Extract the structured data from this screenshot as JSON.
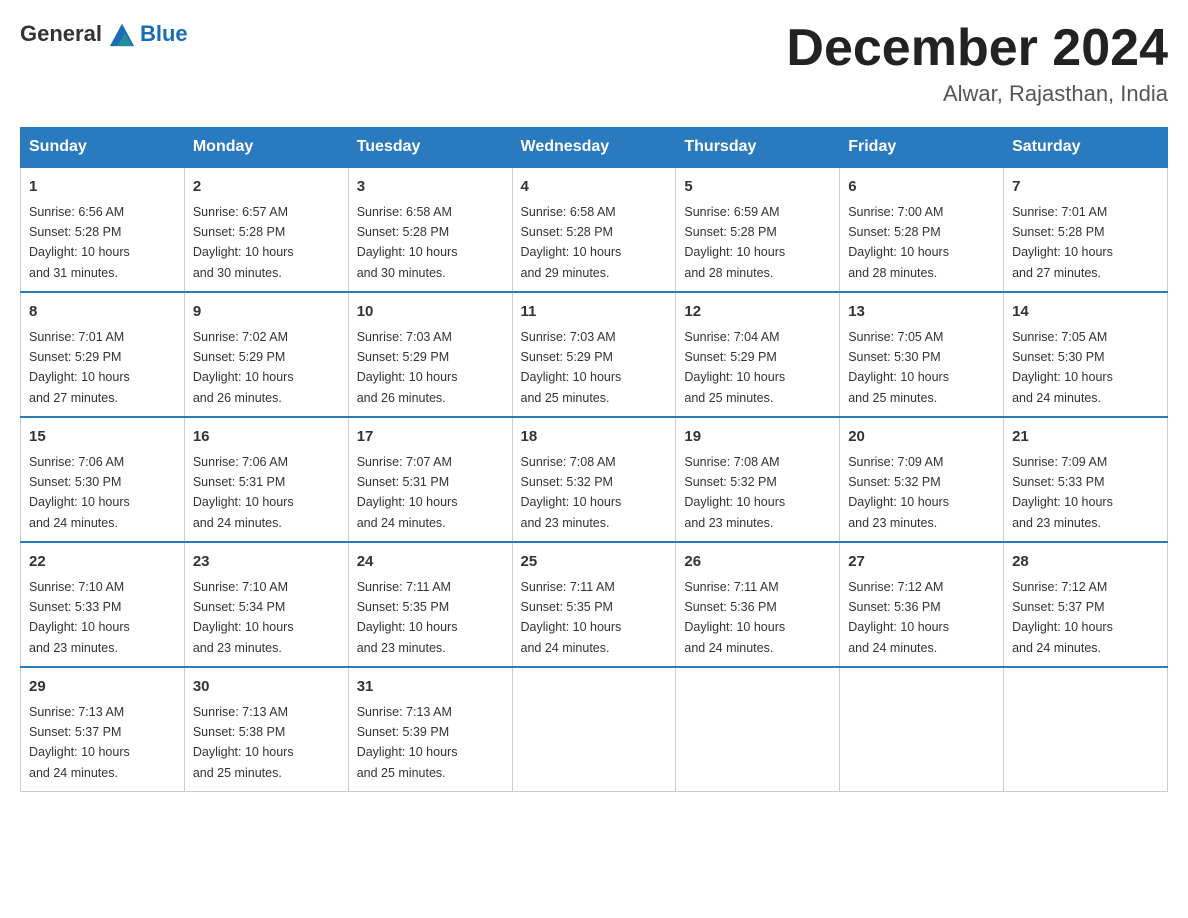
{
  "header": {
    "logo_general": "General",
    "logo_blue": "Blue",
    "month_title": "December 2024",
    "location": "Alwar, Rajasthan, India"
  },
  "days_of_week": [
    "Sunday",
    "Monday",
    "Tuesday",
    "Wednesday",
    "Thursday",
    "Friday",
    "Saturday"
  ],
  "weeks": [
    [
      {
        "day": "1",
        "sunrise": "6:56 AM",
        "sunset": "5:28 PM",
        "daylight": "10 hours and 31 minutes."
      },
      {
        "day": "2",
        "sunrise": "6:57 AM",
        "sunset": "5:28 PM",
        "daylight": "10 hours and 30 minutes."
      },
      {
        "day": "3",
        "sunrise": "6:58 AM",
        "sunset": "5:28 PM",
        "daylight": "10 hours and 30 minutes."
      },
      {
        "day": "4",
        "sunrise": "6:58 AM",
        "sunset": "5:28 PM",
        "daylight": "10 hours and 29 minutes."
      },
      {
        "day": "5",
        "sunrise": "6:59 AM",
        "sunset": "5:28 PM",
        "daylight": "10 hours and 28 minutes."
      },
      {
        "day": "6",
        "sunrise": "7:00 AM",
        "sunset": "5:28 PM",
        "daylight": "10 hours and 28 minutes."
      },
      {
        "day": "7",
        "sunrise": "7:01 AM",
        "sunset": "5:28 PM",
        "daylight": "10 hours and 27 minutes."
      }
    ],
    [
      {
        "day": "8",
        "sunrise": "7:01 AM",
        "sunset": "5:29 PM",
        "daylight": "10 hours and 27 minutes."
      },
      {
        "day": "9",
        "sunrise": "7:02 AM",
        "sunset": "5:29 PM",
        "daylight": "10 hours and 26 minutes."
      },
      {
        "day": "10",
        "sunrise": "7:03 AM",
        "sunset": "5:29 PM",
        "daylight": "10 hours and 26 minutes."
      },
      {
        "day": "11",
        "sunrise": "7:03 AM",
        "sunset": "5:29 PM",
        "daylight": "10 hours and 25 minutes."
      },
      {
        "day": "12",
        "sunrise": "7:04 AM",
        "sunset": "5:29 PM",
        "daylight": "10 hours and 25 minutes."
      },
      {
        "day": "13",
        "sunrise": "7:05 AM",
        "sunset": "5:30 PM",
        "daylight": "10 hours and 25 minutes."
      },
      {
        "day": "14",
        "sunrise": "7:05 AM",
        "sunset": "5:30 PM",
        "daylight": "10 hours and 24 minutes."
      }
    ],
    [
      {
        "day": "15",
        "sunrise": "7:06 AM",
        "sunset": "5:30 PM",
        "daylight": "10 hours and 24 minutes."
      },
      {
        "day": "16",
        "sunrise": "7:06 AM",
        "sunset": "5:31 PM",
        "daylight": "10 hours and 24 minutes."
      },
      {
        "day": "17",
        "sunrise": "7:07 AM",
        "sunset": "5:31 PM",
        "daylight": "10 hours and 24 minutes."
      },
      {
        "day": "18",
        "sunrise": "7:08 AM",
        "sunset": "5:32 PM",
        "daylight": "10 hours and 23 minutes."
      },
      {
        "day": "19",
        "sunrise": "7:08 AM",
        "sunset": "5:32 PM",
        "daylight": "10 hours and 23 minutes."
      },
      {
        "day": "20",
        "sunrise": "7:09 AM",
        "sunset": "5:32 PM",
        "daylight": "10 hours and 23 minutes."
      },
      {
        "day": "21",
        "sunrise": "7:09 AM",
        "sunset": "5:33 PM",
        "daylight": "10 hours and 23 minutes."
      }
    ],
    [
      {
        "day": "22",
        "sunrise": "7:10 AM",
        "sunset": "5:33 PM",
        "daylight": "10 hours and 23 minutes."
      },
      {
        "day": "23",
        "sunrise": "7:10 AM",
        "sunset": "5:34 PM",
        "daylight": "10 hours and 23 minutes."
      },
      {
        "day": "24",
        "sunrise": "7:11 AM",
        "sunset": "5:35 PM",
        "daylight": "10 hours and 23 minutes."
      },
      {
        "day": "25",
        "sunrise": "7:11 AM",
        "sunset": "5:35 PM",
        "daylight": "10 hours and 24 minutes."
      },
      {
        "day": "26",
        "sunrise": "7:11 AM",
        "sunset": "5:36 PM",
        "daylight": "10 hours and 24 minutes."
      },
      {
        "day": "27",
        "sunrise": "7:12 AM",
        "sunset": "5:36 PM",
        "daylight": "10 hours and 24 minutes."
      },
      {
        "day": "28",
        "sunrise": "7:12 AM",
        "sunset": "5:37 PM",
        "daylight": "10 hours and 24 minutes."
      }
    ],
    [
      {
        "day": "29",
        "sunrise": "7:13 AM",
        "sunset": "5:37 PM",
        "daylight": "10 hours and 24 minutes."
      },
      {
        "day": "30",
        "sunrise": "7:13 AM",
        "sunset": "5:38 PM",
        "daylight": "10 hours and 25 minutes."
      },
      {
        "day": "31",
        "sunrise": "7:13 AM",
        "sunset": "5:39 PM",
        "daylight": "10 hours and 25 minutes."
      },
      null,
      null,
      null,
      null
    ]
  ],
  "labels": {
    "sunrise": "Sunrise:",
    "sunset": "Sunset:",
    "daylight": "Daylight:"
  }
}
